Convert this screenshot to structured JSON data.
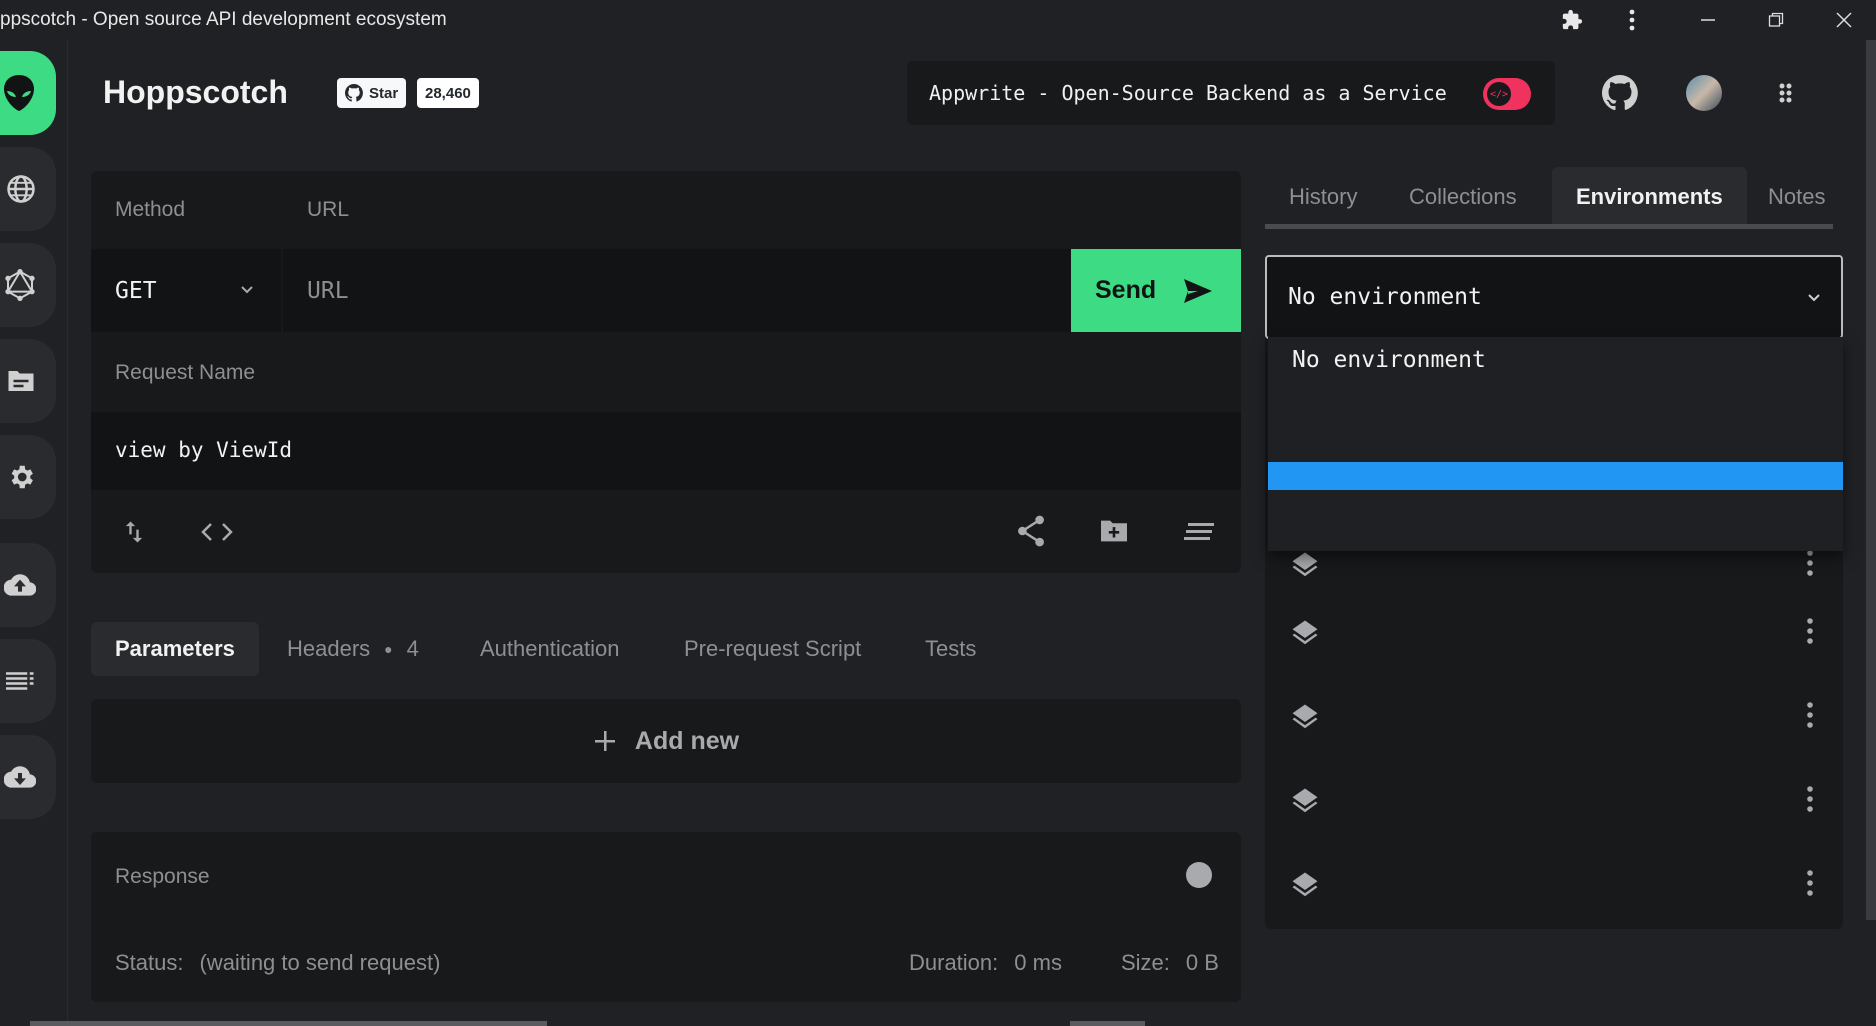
{
  "window": {
    "title": "ppscotch - Open source API development ecosystem"
  },
  "header": {
    "brand": "Hoppscotch",
    "star_label": "Star",
    "star_count": "28,460",
    "promo_text": "Appwrite - Open-Source Backend as a Service"
  },
  "request": {
    "method_label": "Method",
    "url_label": "URL",
    "method_value": "GET",
    "url_placeholder": "URL",
    "send_label": "Send",
    "name_label": "Request Name",
    "name_value": "view by ViewId"
  },
  "tabs": [
    {
      "label": "Parameters",
      "active": true
    },
    {
      "label": "Headers",
      "badge": "4"
    },
    {
      "label": "Authentication"
    },
    {
      "label": "Pre-request Script"
    },
    {
      "label": "Tests"
    }
  ],
  "params": {
    "add_new_label": "Add new"
  },
  "response": {
    "title": "Response",
    "status_label": "Status:",
    "status_value": "(waiting to send request)",
    "duration_label": "Duration:",
    "duration_value": "0 ms",
    "size_label": "Size:",
    "size_value": "0 B"
  },
  "side_tabs": [
    {
      "label": "History"
    },
    {
      "label": "Collections"
    },
    {
      "label": "Environments",
      "active": true
    },
    {
      "label": "Notes"
    }
  ],
  "environments": {
    "selected": "No environment",
    "dropdown_options": [
      "No environment"
    ],
    "rows_visible": 5
  },
  "colors": {
    "accent": "#3ddc84",
    "background": "#202124",
    "panel": "#18191b",
    "highlight": "#2196f3",
    "promo_toggle": "#f0325f"
  }
}
